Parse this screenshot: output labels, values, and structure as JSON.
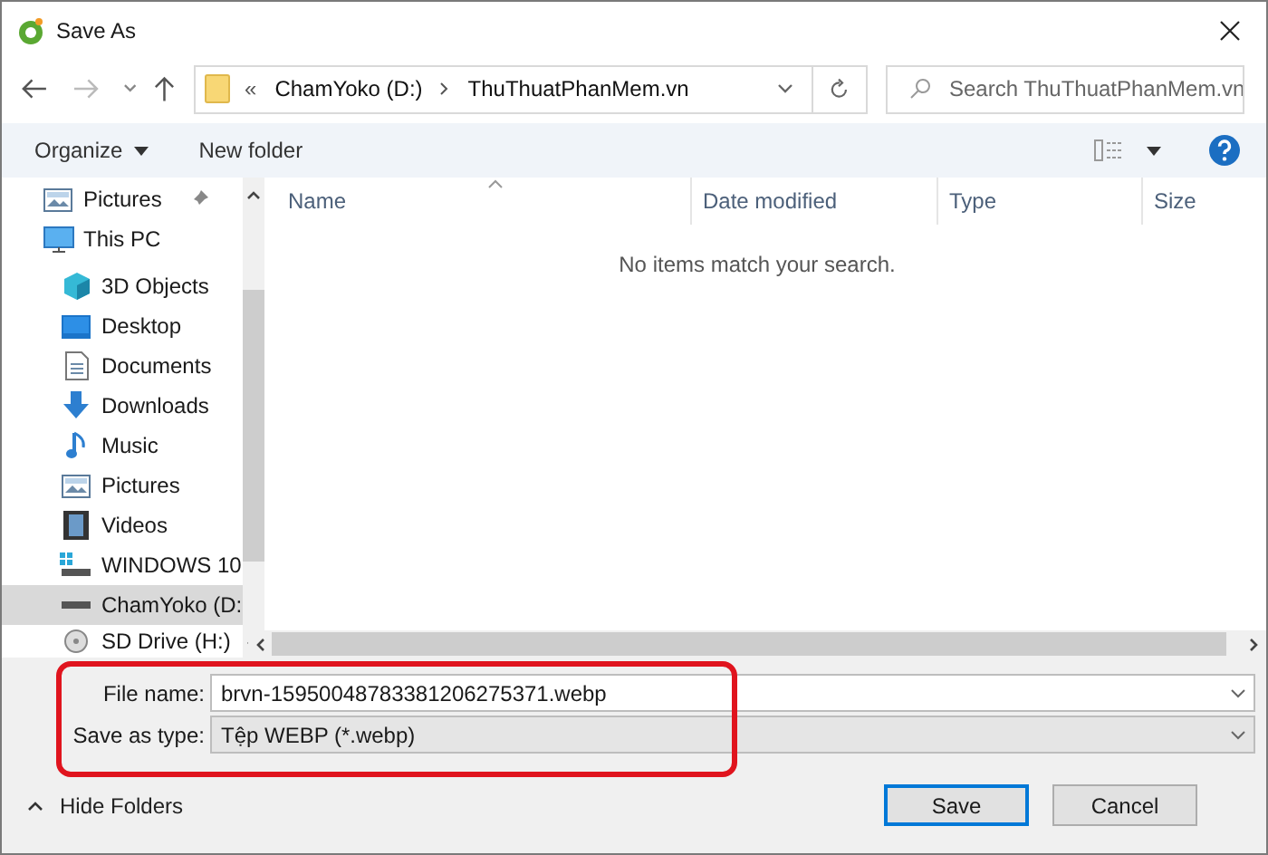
{
  "window": {
    "title": "Save As"
  },
  "address_bar": {
    "overflow": "«",
    "path": [
      "ChamYoko (D:)",
      "ThuThuatPhanMem.vn"
    ]
  },
  "search": {
    "placeholder": "Search ThuThuatPhanMem.vn"
  },
  "toolbar": {
    "organize": "Organize",
    "new_folder": "New folder"
  },
  "sidebar": {
    "items": [
      {
        "label": "Pictures",
        "kind": "pictures",
        "pinned": true,
        "selected": false
      },
      {
        "label": "This PC",
        "kind": "pc",
        "pinned": false,
        "selected": false,
        "children": [
          {
            "label": "3D Objects",
            "kind": "objects3d",
            "pinned": false,
            "selected": false
          },
          {
            "label": "Desktop",
            "kind": "desktop",
            "pinned": false,
            "selected": false
          },
          {
            "label": "Documents",
            "kind": "documents",
            "pinned": false,
            "selected": false
          },
          {
            "label": "Downloads",
            "kind": "downloads",
            "pinned": false,
            "selected": false
          },
          {
            "label": "Music",
            "kind": "music",
            "pinned": false,
            "selected": false
          },
          {
            "label": "Pictures",
            "kind": "pictures",
            "pinned": false,
            "selected": false
          },
          {
            "label": "Videos",
            "kind": "videos",
            "pinned": false,
            "selected": false
          },
          {
            "label": "WINDOWS 10",
            "kind": "windrive",
            "pinned": false,
            "selected": false
          },
          {
            "label": "ChamYoko (D:",
            "kind": "drive",
            "pinned": false,
            "selected": true
          },
          {
            "label": "SD Drive (H:)",
            "kind": "sd",
            "pinned": false,
            "selected": false
          }
        ]
      }
    ]
  },
  "file_list": {
    "columns": [
      "Name",
      "Date modified",
      "Type",
      "Size"
    ],
    "empty_message": "No items match your search."
  },
  "form": {
    "fields": [
      {
        "label": "File name:",
        "value": "brvn-15950048783381206275371.webp",
        "kind": "text"
      },
      {
        "label": "Save as type:",
        "value": "Tệp WEBP (*.webp)",
        "kind": "select"
      }
    ]
  },
  "hide_folders": "Hide Folders",
  "buttons": [
    {
      "label": "Save",
      "default": true
    },
    {
      "label": "Cancel",
      "default": false
    }
  ]
}
